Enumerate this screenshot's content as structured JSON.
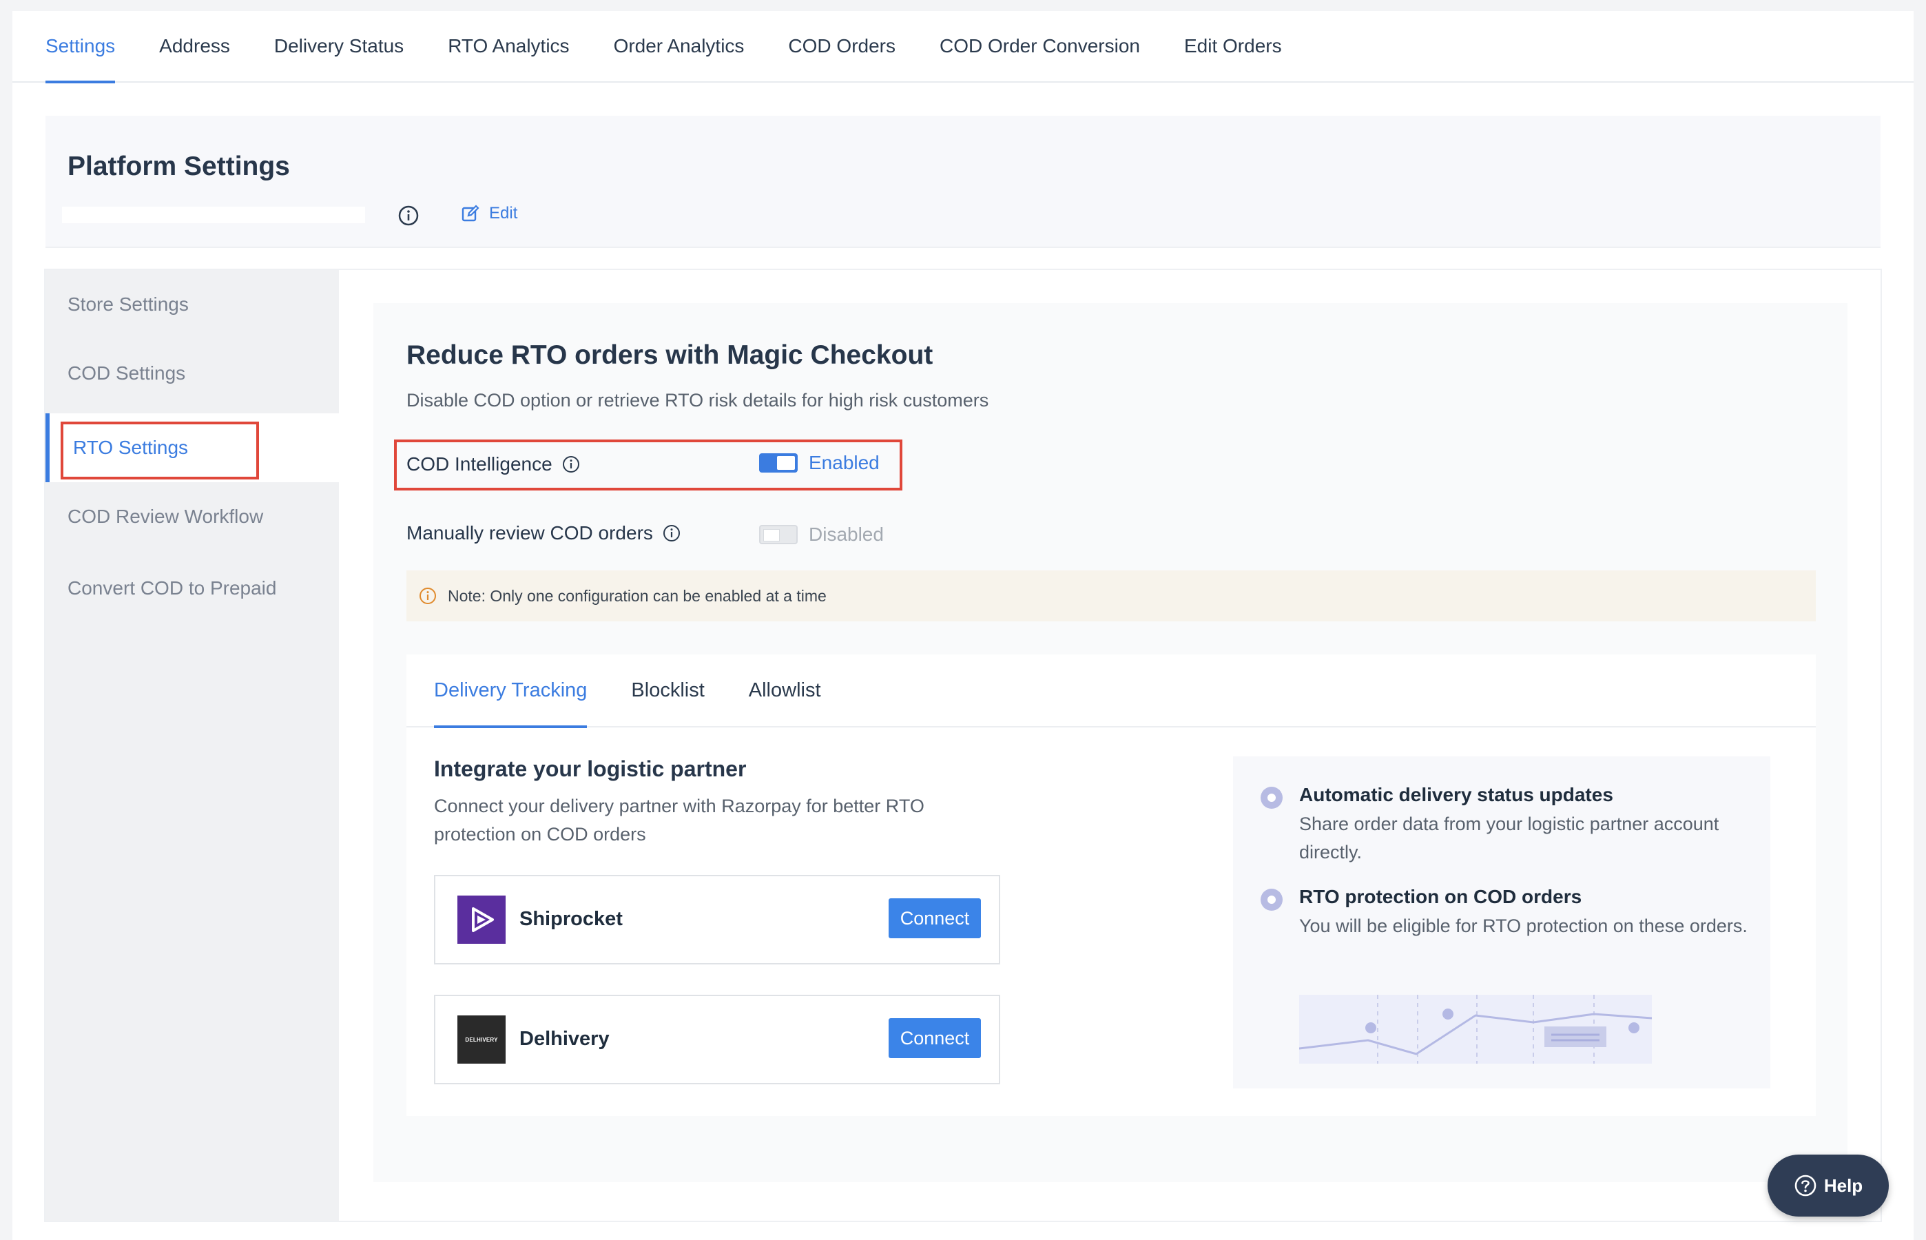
{
  "top_tabs": [
    "Settings",
    "Address",
    "Delivery Status",
    "RTO Analytics",
    "Order Analytics",
    "COD Orders",
    "COD Order Conversion",
    "Edit Orders"
  ],
  "active_top_tab": "Settings",
  "platform": {
    "title": "Platform Settings",
    "edit_label": "Edit"
  },
  "sidebar": {
    "items": [
      {
        "label": "Store Settings"
      },
      {
        "label": "COD Settings"
      },
      {
        "label": "RTO Settings"
      },
      {
        "label": "COD Review Workflow"
      },
      {
        "label": "Convert COD to Prepaid"
      }
    ],
    "active": "RTO Settings"
  },
  "rto": {
    "title": "Reduce RTO orders with Magic Checkout",
    "subtitle": "Disable COD option or retrieve RTO risk details for high risk customers",
    "cod_intelligence": {
      "label": "COD Intelligence",
      "status": "Enabled"
    },
    "manual_review": {
      "label": "Manually review COD orders",
      "status": "Disabled"
    },
    "note": "Note: Only one configuration can be enabled at a time"
  },
  "inner_tabs": [
    "Delivery Tracking",
    "Blocklist",
    "Allowlist"
  ],
  "active_inner_tab": "Delivery Tracking",
  "integrate": {
    "title": "Integrate your logistic partner",
    "description": "Connect your delivery partner with Razorpay for better RTO protection on COD orders",
    "partners": [
      {
        "name": "Shiprocket",
        "button": "Connect",
        "logo_text": ""
      },
      {
        "name": "Delhivery",
        "button": "Connect",
        "logo_text": "DELHIVERY"
      }
    ]
  },
  "benefits": [
    {
      "title": "Automatic delivery status updates",
      "description": "Share order data from your logistic partner account directly."
    },
    {
      "title": "RTO protection on COD orders",
      "description": "You will be eligible for RTO protection on these orders."
    }
  ],
  "help_label": "Help",
  "colors": {
    "accent": "#3b7ce0",
    "highlight": "#e0473a",
    "help_bg": "#2f3d55"
  }
}
